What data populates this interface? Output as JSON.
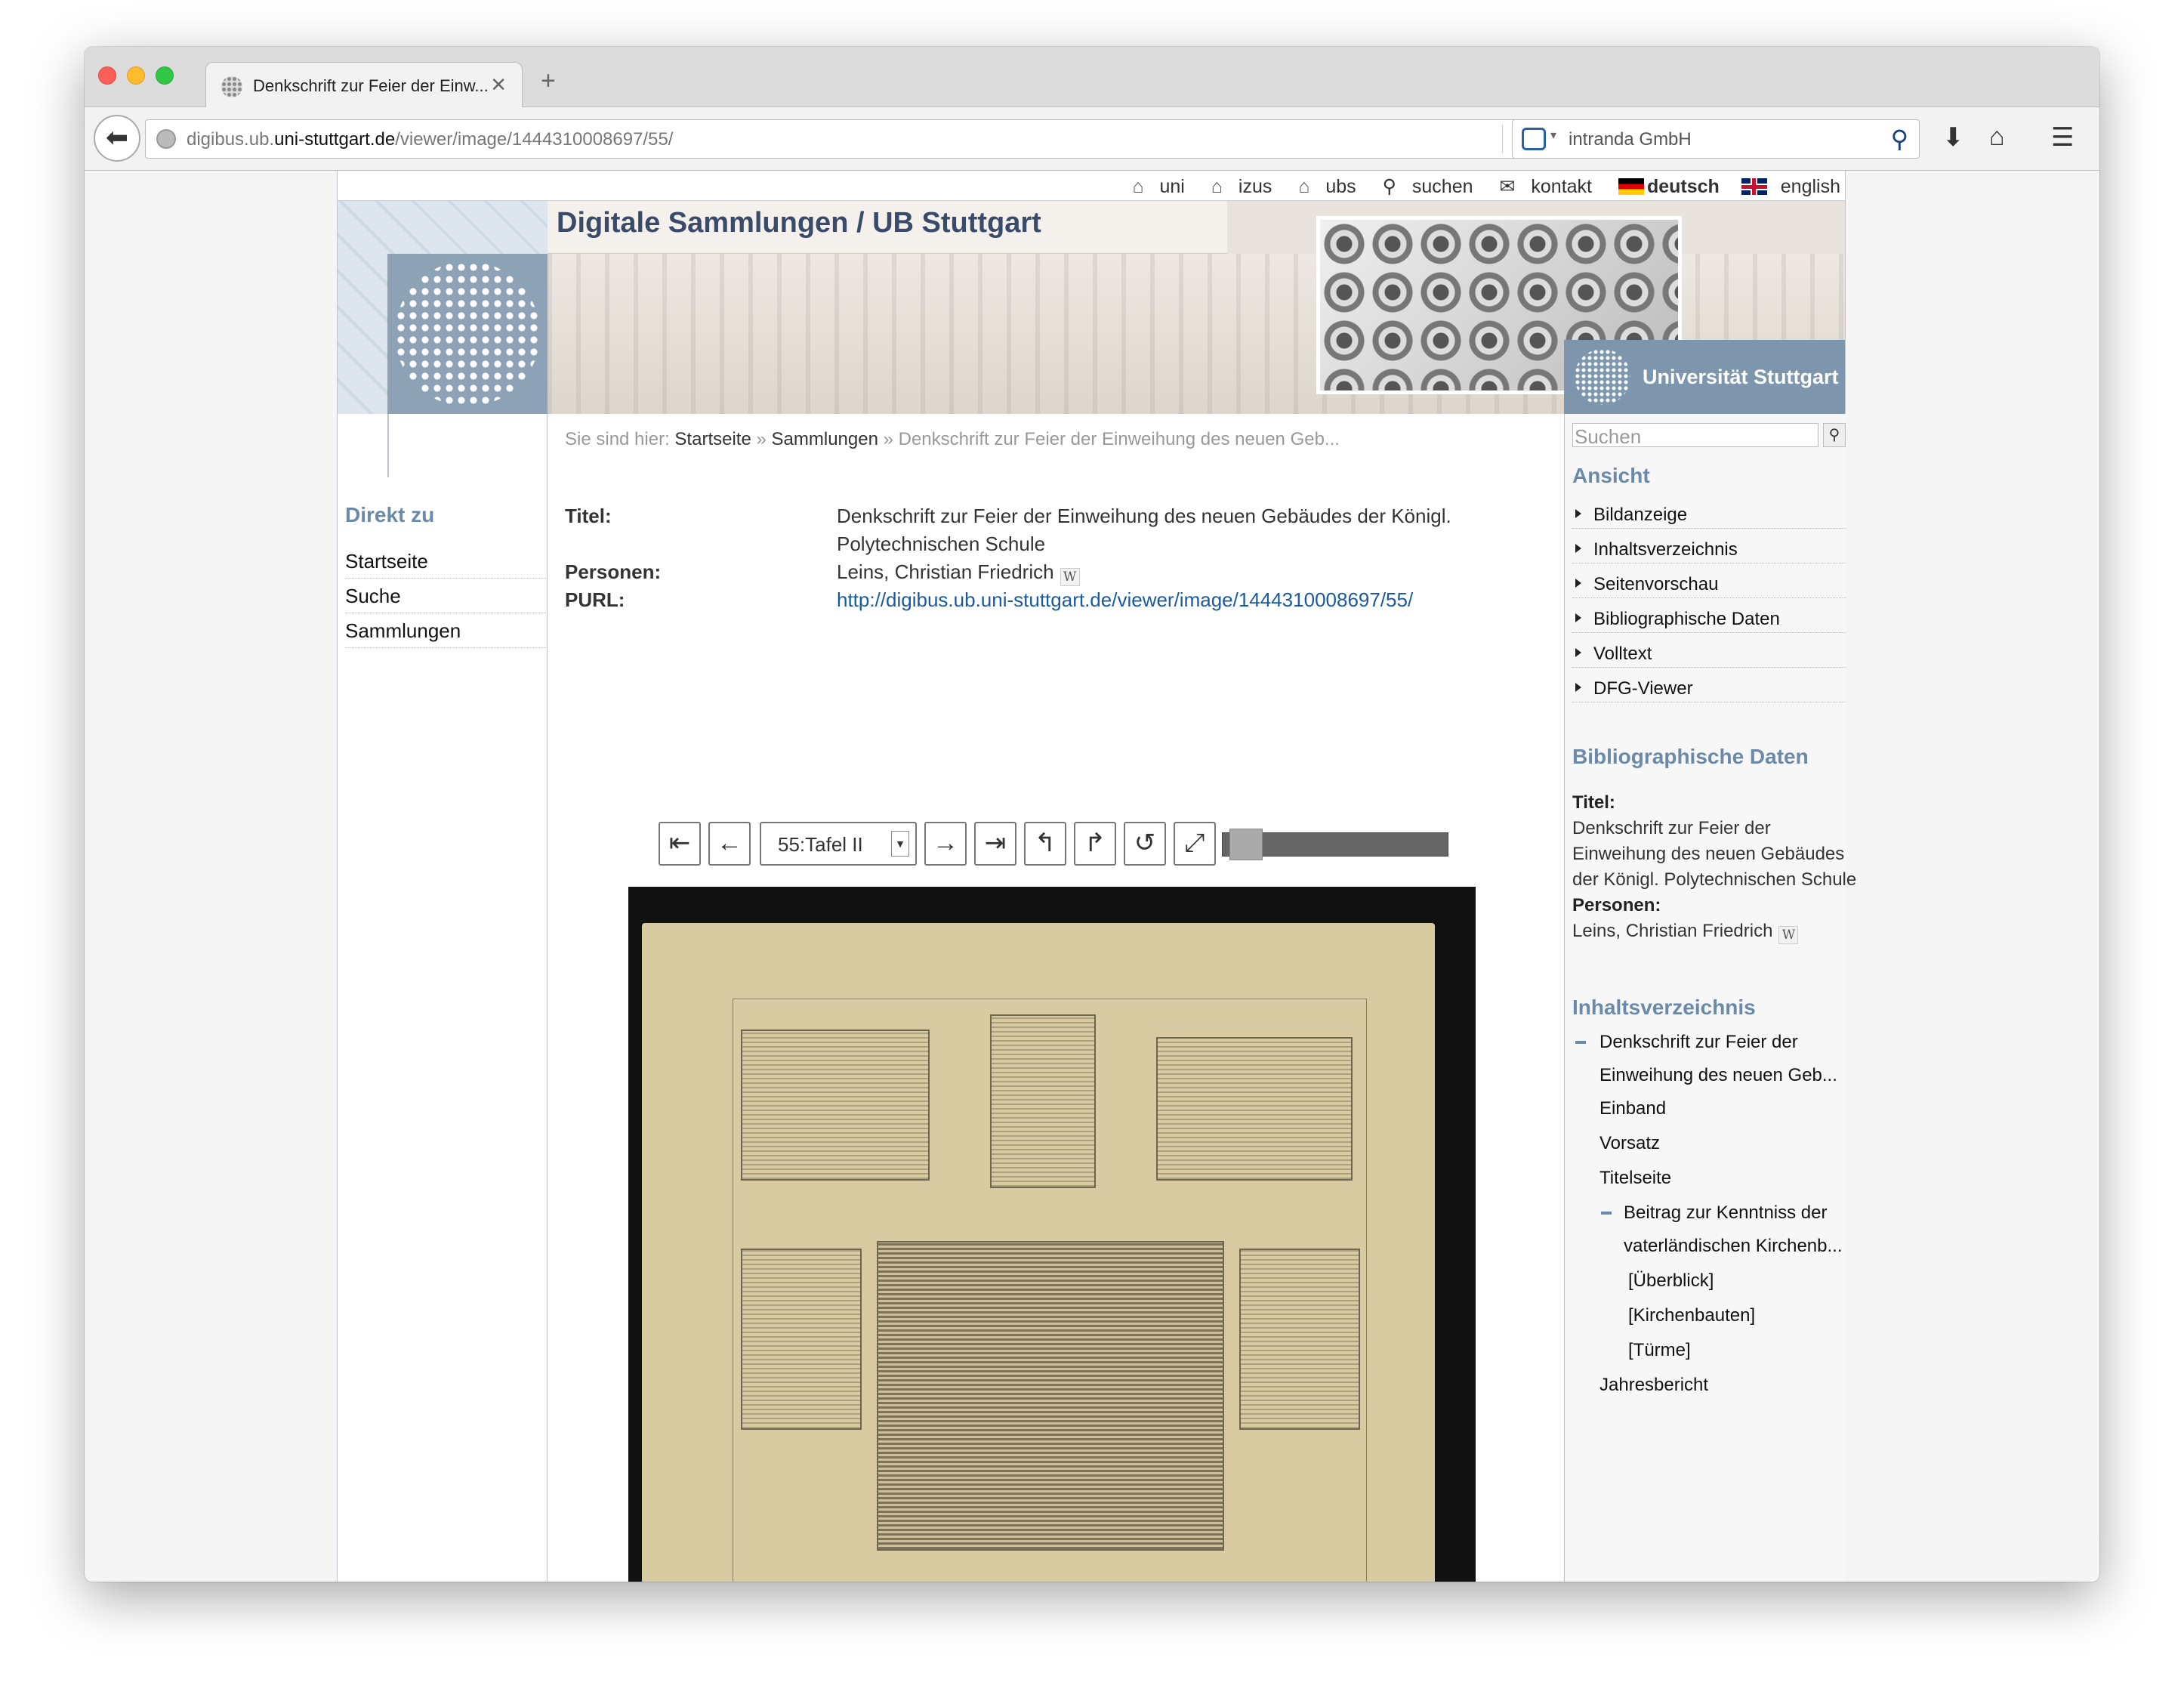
{
  "browser": {
    "tab_title": "Denkschrift zur Feier der Einw...",
    "url_host_prefix": "digibus.ub.",
    "url_host": "uni-stuttgart.de",
    "url_path": "/viewer/image/1444310008697/55/",
    "search_engine": "intranda GmbH"
  },
  "topnav": {
    "uni": "uni",
    "izus": "izus",
    "ubs": "ubs",
    "suchen": "suchen",
    "kontakt": "kontakt",
    "deutsch": "deutsch",
    "english": "english"
  },
  "header": {
    "title": "Digitale Sammlungen / UB Stuttgart",
    "university": "Universität Stuttgart"
  },
  "left": {
    "heading": "Direkt zu",
    "items": [
      "Startseite",
      "Suche",
      "Sammlungen"
    ]
  },
  "breadcrumb": {
    "prefix": "Sie sind hier:",
    "items": [
      "Startseite",
      "Sammlungen"
    ],
    "current": "» Denkschrift zur Feier der Einweihung des neuen Geb...",
    "sep": "»"
  },
  "meta": {
    "titel_label": "Titel:",
    "titel_line1": "Denkschrift zur Feier der Einweihung des neuen Gebäudes der Königl.",
    "titel_line2": "Polytechnischen Schule",
    "personen_label": "Personen:",
    "personen": "Leins, Christian Friedrich",
    "purl_label": "PURL:",
    "purl": "http://digibus.ub.uni-stuttgart.de/viewer/image/1444310008697/55/",
    "wiki_badge": "W"
  },
  "viewer": {
    "page_select": "55:Tafel II",
    "zoom_level": 0.05
  },
  "right": {
    "search_placeholder": "Suchen",
    "ansicht_heading": "Ansicht",
    "ansicht_items": [
      "Bildanzeige",
      "Inhaltsverzeichnis",
      "Seitenvorschau",
      "Bibliographische Daten",
      "Volltext",
      "DFG-Viewer"
    ],
    "bib_heading": "Bibliographische Daten",
    "bib_titel_label": "Titel:",
    "bib_titel_l1": "Denkschrift zur Feier der",
    "bib_titel_l2": "Einweihung des neuen Gebäudes",
    "bib_titel_l3": "der Königl. Polytechnischen Schule",
    "bib_personen_label": "Personen:",
    "bib_personen": "Leins, Christian Friedrich",
    "toc_heading": "Inhaltsverzeichnis",
    "toc": {
      "root_l1": "Denkschrift zur Feier der",
      "root_l2": "Einweihung des neuen Geb...",
      "einband": "Einband",
      "vorsatz": "Vorsatz",
      "titelseite": "Titelseite",
      "beitrag_l1": "Beitrag zur Kenntniss der",
      "beitrag_l2": "vaterländischen Kirchenb...",
      "ueberblick": "[Überblick]",
      "kirchenbauten": "[Kirchenbauten]",
      "tuerme": "[Türme]",
      "jahresbericht": "Jahresbericht"
    }
  }
}
